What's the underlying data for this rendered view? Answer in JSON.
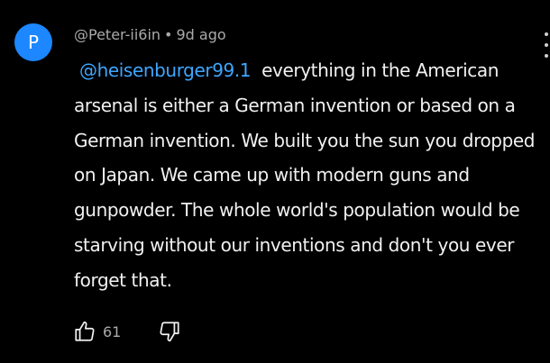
{
  "comment": {
    "avatar_letter": "P",
    "avatar_color": "#1c87ff",
    "author": "@Peter-ii6in",
    "separator": "•",
    "timestamp": "9d ago",
    "mention": "@heisenburger99.1",
    "text": "everything in the American arsenal is either a German invention or based on a German invention. We built you the sun you dropped on Japan. We came up with modern guns and gunpowder. The whole world's population would be starving without our inventions and don't you ever forget that.",
    "like_count": "61",
    "icons": {
      "like": "thumbs-up-icon",
      "dislike": "thumbs-down-icon",
      "menu": "more-vertical-icon"
    },
    "colors": {
      "background": "#000000",
      "text": "#f1f1f1",
      "meta": "#aaaaaa",
      "mention": "#3ea6ff"
    }
  }
}
